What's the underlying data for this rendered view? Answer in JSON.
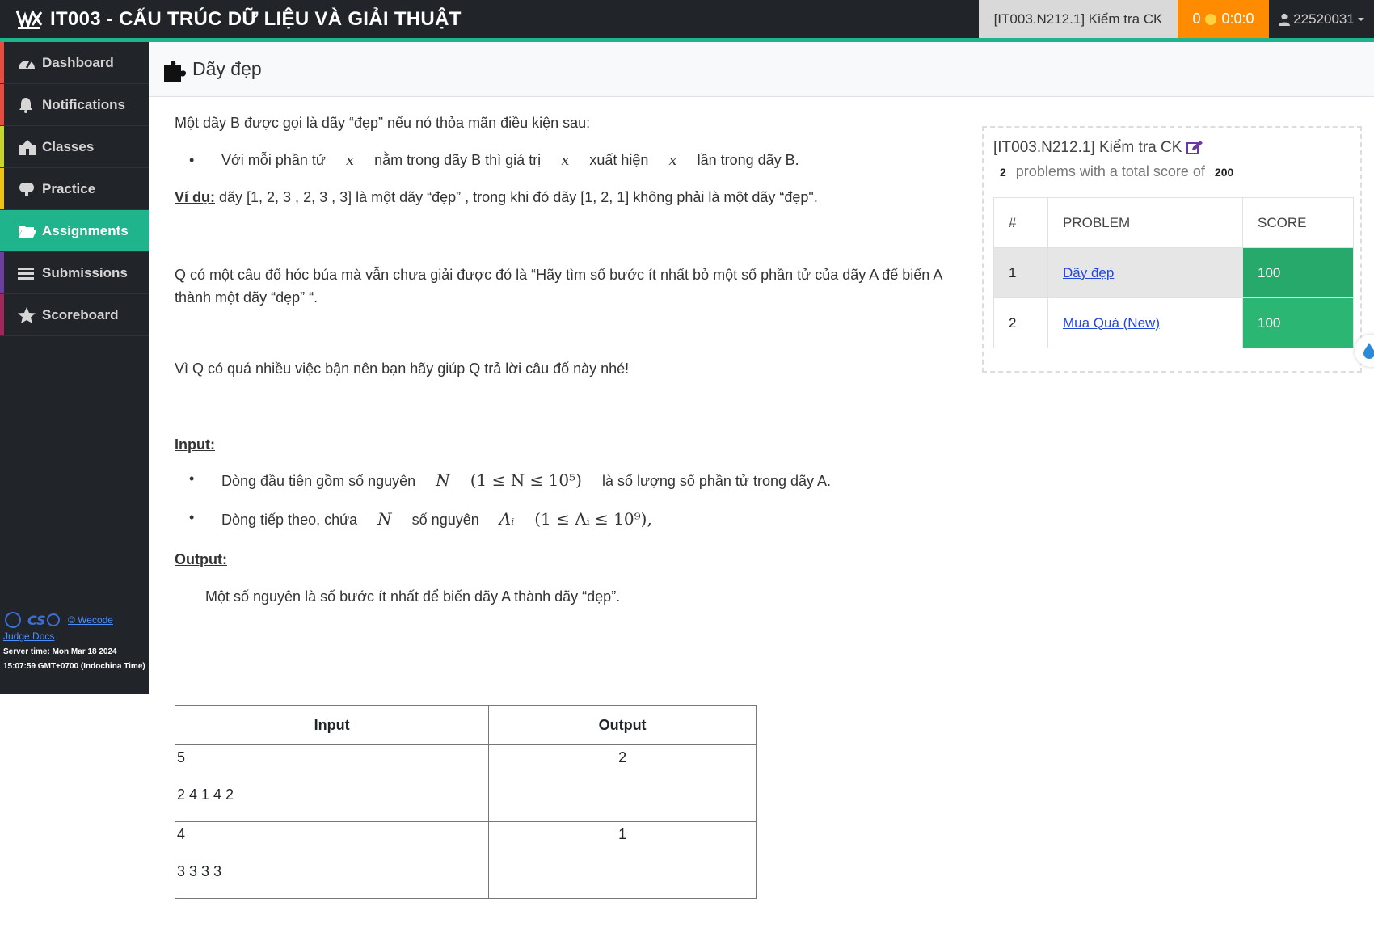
{
  "header": {
    "brand": "IT003 - CẤU TRÚC DỮ LIỆU VÀ GIẢI THUẬT",
    "assignment": "[IT003.N212.1] Kiểm tra CK",
    "timer_count": "0",
    "timer_value": "0:0:0",
    "user": "22520031",
    "colors": {
      "accent": "#20b48c",
      "timer": "#ff8c00"
    }
  },
  "sidebar": {
    "items": [
      {
        "label": "Dashboard",
        "icon": "dashboard-icon",
        "color": "#e74c3c"
      },
      {
        "label": "Notifications",
        "icon": "bell-icon",
        "color": "#e74c3c"
      },
      {
        "label": "Classes",
        "icon": "school-icon",
        "color": "#c8d62b"
      },
      {
        "label": "Practice",
        "icon": "brain-icon",
        "color": "#f1c40f"
      },
      {
        "label": "Assignments",
        "icon": "folder-open-icon",
        "color": "#20b48c"
      },
      {
        "label": "Submissions",
        "icon": "list-icon",
        "color": "#6c3ea0"
      },
      {
        "label": "Scoreboard",
        "icon": "star-icon",
        "color": "#a0285a"
      }
    ],
    "footer": {
      "link1": "© Wecode",
      "link2": "Judge Docs",
      "server_time": "Server time: Mon Mar 18 2024 15:07:59 GMT+0700 (Indochina Time)"
    }
  },
  "page": {
    "title": "Dãy đẹp"
  },
  "problem": {
    "intro": "Một dãy B được gọi là dãy “đẹp” nếu nó thỏa mãn điều kiện sau:",
    "cond_a": "Với mỗi phần tử ",
    "cond_b": " nằm trong dãy B thì giá trị ",
    "cond_c": " xuất hiện ",
    "cond_d": " lần trong dãy B.",
    "var_x": "x",
    "example_label": "Ví dụ:",
    "example_text": " dãy [1, 2, 3 , 2, 3 , 3] là một dãy “đẹp” , trong khi đó dãy [1, 2, 1] không phải là một dãy “đẹp\".",
    "story": "Q có một câu đố hóc búa mà vẫn chưa giải được đó là “Hãy tìm số bước ít nhất bỏ một số phần tử của dãy A để biến A thành một dãy “đẹp” “.",
    "help": "Vì Q có quá nhiều việc bận nên bạn hãy giúp Q trả lời câu đố này nhé!",
    "input_label": "Input:",
    "in1_a": "Dòng đầu tiên gồm số nguyên ",
    "in1_b": " là số lượng số phần tử trong dãy A.",
    "in2_a": "Dòng tiếp theo, chứa ",
    "in2_b": " số nguyên ",
    "math_N": "N",
    "math_N_range": "(1 ≤ N ≤ 10⁵)",
    "math_A": "Aᵢ",
    "math_A_range": "(1 ≤ Aᵢ ≤ 10⁹),",
    "output_label": "Output:",
    "output_text": "Một số nguyên là số bước ít nhất để biến dãy A thành dãy “đẹp”."
  },
  "samples": {
    "headers": [
      "Input",
      "Output"
    ],
    "rows": [
      {
        "input_l1": "5",
        "input_l2": "2 4 1 4 2",
        "output": "2"
      },
      {
        "input_l1": "4",
        "input_l2": "3 3 3 3",
        "output": "1"
      }
    ]
  },
  "panel": {
    "title": "[IT003.N212.1] Kiểm tra CK",
    "count": "2",
    "sub_text": "problems with a total score of",
    "total": "200",
    "headers": [
      "#",
      "PROBLEM",
      "SCORE"
    ],
    "rows": [
      {
        "num": "1",
        "name": "Dãy đẹp",
        "score": "100"
      },
      {
        "num": "2",
        "name": "Mua Quà (New)",
        "score": "100"
      }
    ]
  }
}
